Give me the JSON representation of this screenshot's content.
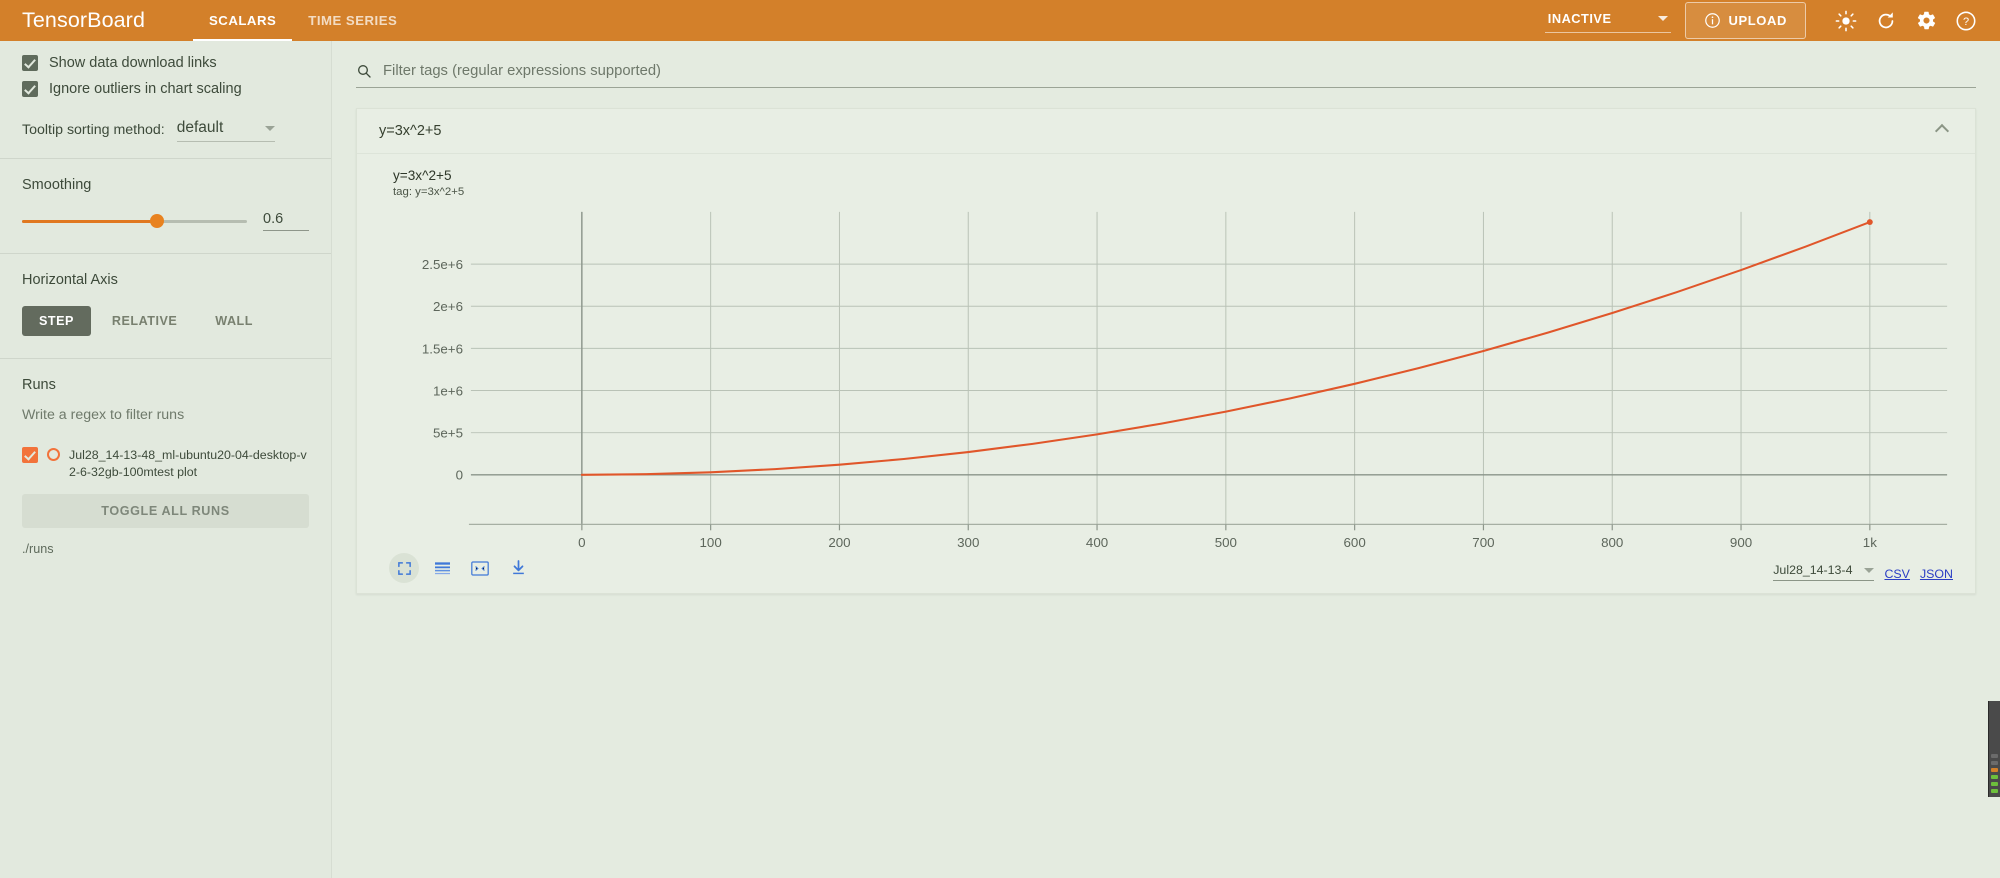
{
  "header": {
    "brand": "TensorBoard",
    "tabs": [
      {
        "label": "SCALARS",
        "active": true
      },
      {
        "label": "TIME SERIES",
        "active": false
      }
    ],
    "status_select": "INACTIVE",
    "upload_label": "UPLOAD",
    "icons": [
      "brightness-icon",
      "refresh-icon",
      "settings-icon",
      "help-icon"
    ],
    "accent_color": "#d3802a"
  },
  "sidebar": {
    "checkboxes": [
      {
        "label": "Show data download links",
        "checked": true
      },
      {
        "label": "Ignore outliers in chart scaling",
        "checked": true
      }
    ],
    "tooltip_sorting": {
      "label": "Tooltip sorting method:",
      "value": "default"
    },
    "smoothing": {
      "title": "Smoothing",
      "value": "0.6",
      "fraction": 0.6
    },
    "horizontal_axis": {
      "title": "Horizontal Axis",
      "options": [
        {
          "label": "STEP",
          "active": true
        },
        {
          "label": "RELATIVE",
          "active": false
        },
        {
          "label": "WALL",
          "active": false
        }
      ]
    },
    "runs": {
      "title": "Runs",
      "filter_placeholder": "Write a regex to filter runs",
      "items": [
        {
          "name": "Jul28_14-13-48_ml-ubuntu20-04-desktop-v2-6-32gb-100mtest plot",
          "checked": true,
          "color": "#f2733b"
        }
      ],
      "toggle_all_label": "TOGGLE ALL RUNS",
      "path": "./runs"
    }
  },
  "main": {
    "filter_placeholder": "Filter tags (regular expressions supported)",
    "card": {
      "header_title": "y=3x^2+5",
      "collapse_icon": "chevron-up-icon",
      "chart_title": "y=3x^2+5",
      "chart_tag": "tag: y=3x^2+5",
      "toolbar": [
        "fullscreen-icon",
        "data-table-icon",
        "fit-domain-icon",
        "download-icon"
      ],
      "run_select_value": "Jul28_14-13-4",
      "csv_label": "CSV",
      "json_label": "JSON"
    }
  },
  "chart_data": {
    "type": "line",
    "title": "y=3x^2+5",
    "subtitle": "tag: y=3x^2+5",
    "xlabel": "",
    "ylabel": "",
    "xlim": [
      -80,
      1060
    ],
    "ylim": [
      -330000,
      3120000
    ],
    "grid": true,
    "legend": false,
    "line_color": "#e0562a",
    "x_ticks": [
      0,
      100,
      200,
      300,
      400,
      500,
      600,
      700,
      800,
      900,
      1000
    ],
    "x_tick_labels": [
      "0",
      "100",
      "200",
      "300",
      "400",
      "500",
      "600",
      "700",
      "800",
      "900",
      "1k"
    ],
    "y_ticks": [
      0,
      500000,
      1000000,
      1500000,
      2000000,
      2500000
    ],
    "y_tick_labels": [
      "0",
      "5e+5",
      "1e+6",
      "1.5e+6",
      "2e+6",
      "2.5e+6"
    ],
    "series": [
      {
        "name": "Jul28_14-13-48_ml-ubuntu20-04-desktop-v2-6-32gb-100mtest plot",
        "color": "#e0562a",
        "x": [
          0,
          50,
          100,
          150,
          200,
          250,
          300,
          350,
          400,
          450,
          500,
          550,
          600,
          650,
          700,
          750,
          800,
          850,
          900,
          950,
          1000
        ],
        "y": [
          5,
          7505,
          30005,
          67505,
          120005,
          187505,
          270005,
          367505,
          480005,
          607505,
          750005,
          907505,
          1080005,
          1267505,
          1470005,
          1687505,
          1920005,
          2167505,
          2430005,
          2707505,
          3000005
        ]
      }
    ]
  }
}
